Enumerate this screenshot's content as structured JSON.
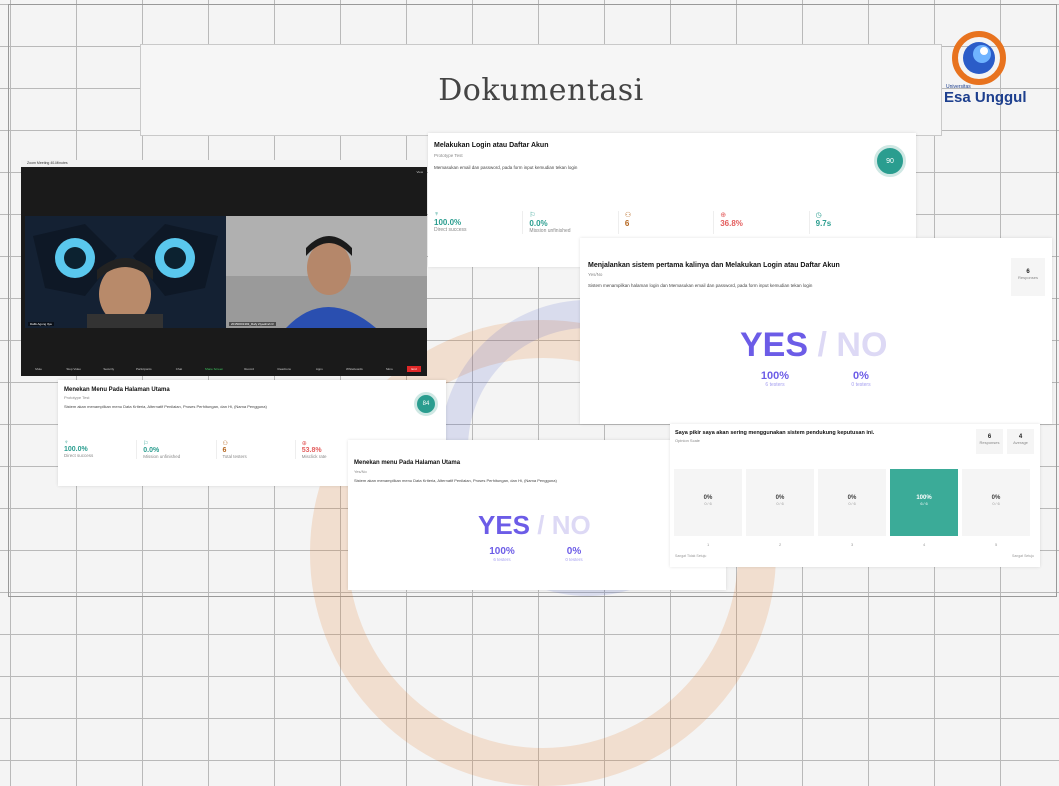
{
  "slide_title": "Dokumentasi",
  "logo": {
    "sub": "Universitas",
    "name": "Esa Unggul"
  },
  "card_login": {
    "title": "Melakukan Login atau Daftar Akun",
    "subtitle": "Prototype Test",
    "description": "Memasukan email dan password, pada form input kemudian tekan login",
    "score": "90",
    "stats": [
      {
        "value": "100.0%",
        "label": "Direct success",
        "color": "#2a9d8f"
      },
      {
        "value": "0.0%",
        "label": "Mission unfinished",
        "color": "#2a9d8f"
      },
      {
        "value": "6",
        "label": "",
        "color": "#b5651d"
      },
      {
        "value": "36.8%",
        "label": "",
        "color": "#e35d5d"
      },
      {
        "value": "9.7s",
        "label": "",
        "color": "#2a9d8f"
      }
    ]
  },
  "zoom": {
    "window_title": "Zoom Meeting 40-Minutes",
    "view_label": "View",
    "participant_1": "Dafik Agung Ilya",
    "participant_2": "20150001393_Rafy Ziyadrrah R",
    "tools": [
      "Mute",
      "Stop Video",
      "Security",
      "Participants",
      "Chat",
      "Share Screen",
      "Record",
      "Reactions",
      "Apps",
      "Whiteboards",
      "More"
    ],
    "end_label": "End"
  },
  "card_first_run": {
    "title": "Menjalankan sistem pertama kalinya dan Melakukan Login atau Daftar Akun",
    "subtitle": "Yes/No",
    "description": "Sistem menampilkan halaman login dan Memasukan email dan password, pada form input kemudian tekan login",
    "responses_count": "6",
    "responses_label": "Responses",
    "yes": "YES",
    "no": "/ NO",
    "yes_pct": "100%",
    "yes_testers": "6 testers",
    "no_pct": "0%",
    "no_testers": "0 testers"
  },
  "card_menu": {
    "title": "Menekan Menu Pada Halaman Utama",
    "subtitle": "Prototype Test",
    "description": "Sistem akan menampilkan menu Data Kriteria, Alternatif Penilaian, Proses Perhitungan, dan Hi, (Nama Pengguna)",
    "score": "84",
    "stats": [
      {
        "value": "100.0%",
        "label": "Direct success",
        "color": "#2a9d8f"
      },
      {
        "value": "0.0%",
        "label": "Mission unfinished",
        "color": "#2a9d8f"
      },
      {
        "value": "6",
        "label": "Total testers",
        "color": "#b5651d"
      },
      {
        "value": "53.8%",
        "label": "Misclick rate",
        "color": "#e35d5d"
      }
    ]
  },
  "card_menu_yesno": {
    "title": "Menekan menu Pada Halaman Utama",
    "subtitle": "Yes/No",
    "description": "Sistem akan menampilkan menu Data Kriteria, Alternatif Penilaian, Proses Perhitungan, dan Hi, (Nama Pengguna)",
    "yes": "YES",
    "no": "/ NO",
    "yes_pct": "100%",
    "yes_testers": "6 testers",
    "no_pct": "0%",
    "no_testers": "0 testers"
  },
  "card_opinion": {
    "title": "Saya pikir saya akan sering menggunakan sistem pendukung keputusan ini.",
    "subtitle": "Opinion Scale",
    "responses_count": "6",
    "responses_label": "Responses",
    "average_value": "4",
    "average_label": "Average",
    "options": [
      {
        "pct": "0%",
        "sub": "0 ⁄ 6",
        "num": "1"
      },
      {
        "pct": "0%",
        "sub": "0 ⁄ 6",
        "num": "2"
      },
      {
        "pct": "0%",
        "sub": "0 ⁄ 6",
        "num": "3"
      },
      {
        "pct": "100%",
        "sub": "6 ⁄ 6",
        "num": "4"
      },
      {
        "pct": "0%",
        "sub": "0 ⁄ 6",
        "num": "5"
      }
    ],
    "left_anchor": "Sangat Tidak Setuju",
    "right_anchor": "Sangat Setuju",
    "selected_color": "#3bab98"
  }
}
